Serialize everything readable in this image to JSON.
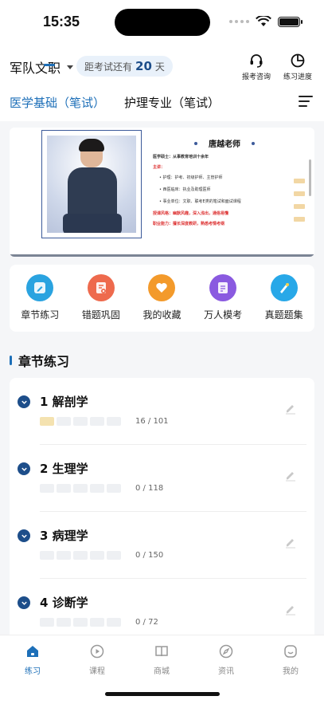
{
  "status": {
    "time": "15:35"
  },
  "header": {
    "category": "军队文职",
    "countdown": {
      "prefix": "距考试还有",
      "days": "20",
      "suffix": "天"
    },
    "actions": [
      {
        "label": "报考咨询",
        "icon": "headset-icon"
      },
      {
        "label": "练习进度",
        "icon": "pie-chart-icon"
      }
    ],
    "tabs": [
      {
        "label": "医学基础（笔试）",
        "active": true
      },
      {
        "label": "护理专业（笔试）",
        "active": false
      }
    ]
  },
  "banner": {
    "teacher_name": "唐越老师",
    "lines": [
      {
        "text": "医学硕士：从事教育培训十余年",
        "style": "bold"
      },
      {
        "text": "主讲：",
        "style": "red"
      }
    ],
    "items": [
      "• 护理：护考、初级护师、主管护师",
      "• 西医临床：执业及助理医师",
      "• 事业单位：文职、联考E类的笔试和面试课程"
    ],
    "footer_lines": [
      {
        "text": "授课风格：幽默风趣，深入浅出，通俗易懂",
        "style": "red"
      },
      {
        "text": "职业能力：擅长深度教研，熟悉考情考纲",
        "style": "red"
      }
    ]
  },
  "quick_actions": [
    {
      "label": "章节练习",
      "icon": "pencil-icon",
      "color": "#2aa3e0"
    },
    {
      "label": "错题巩固",
      "icon": "wrong-book-icon",
      "color": "#ee6a4d"
    },
    {
      "label": "我的收藏",
      "icon": "heart-icon",
      "color": "#f39a2b"
    },
    {
      "label": "万人模考",
      "icon": "exam-paper-icon",
      "color": "#8a5ae0"
    },
    {
      "label": "真题题集",
      "icon": "brush-icon",
      "color": "#28a8e8"
    }
  ],
  "section": {
    "title": "章节练习"
  },
  "chapters": [
    {
      "name": "1 解剖学",
      "count": "16 / 101",
      "done_segments": 1
    },
    {
      "name": "2 生理学",
      "count": "0 / 118",
      "done_segments": 0
    },
    {
      "name": "3 病理学",
      "count": "0 / 150",
      "done_segments": 0
    },
    {
      "name": "4 诊断学",
      "count": "0 / 72",
      "done_segments": 0
    }
  ],
  "tabbar": [
    {
      "label": "练习",
      "icon": "home-icon",
      "active": true
    },
    {
      "label": "课程",
      "icon": "play-icon",
      "active": false
    },
    {
      "label": "商城",
      "icon": "book-icon",
      "active": false
    },
    {
      "label": "资讯",
      "icon": "compass-icon",
      "active": false
    },
    {
      "label": "我的",
      "icon": "profile-icon",
      "active": false
    }
  ],
  "colors": {
    "accent": "#1d6fb8",
    "dark_accent": "#1d4e8a"
  }
}
